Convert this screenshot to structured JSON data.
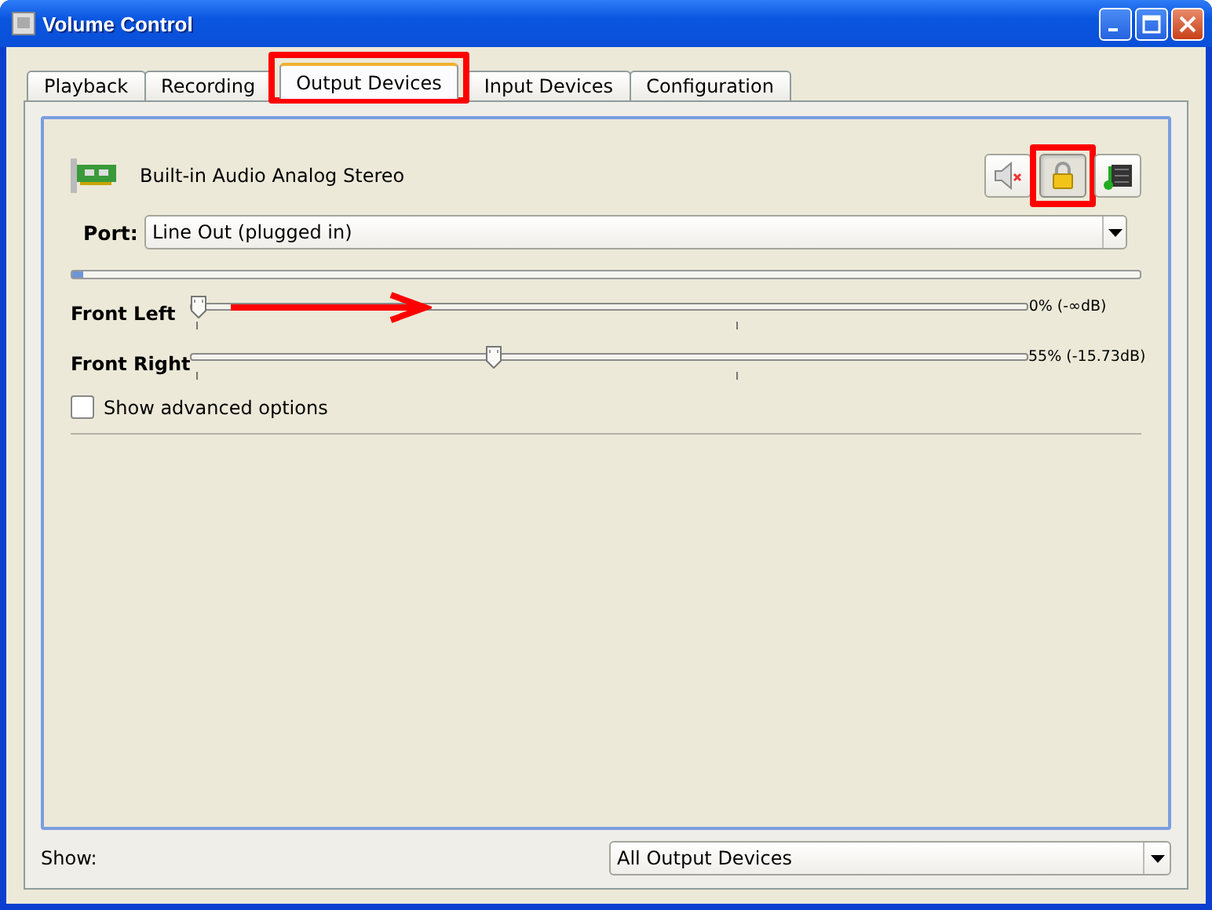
{
  "window": {
    "title": "Volume Control"
  },
  "tabs": [
    {
      "label": "Playback",
      "selected": false,
      "highlighted": false
    },
    {
      "label": "Recording",
      "selected": false,
      "highlighted": false
    },
    {
      "label": "Output Devices",
      "selected": true,
      "highlighted": true
    },
    {
      "label": "Input Devices",
      "selected": false,
      "highlighted": false
    },
    {
      "label": "Configuration",
      "selected": false,
      "highlighted": false
    }
  ],
  "device": {
    "name": "Built-in Audio Analog Stereo",
    "muted": false,
    "locked": true,
    "lock_highlighted": true,
    "port": {
      "label": "Port:",
      "value": "Line Out (plugged in)"
    },
    "meter": {
      "level": 0.01
    },
    "channels": [
      {
        "name": "Front Left",
        "level": 0,
        "reading": "0% (-∞dB)",
        "arrow": true
      },
      {
        "name": "Front Right",
        "level": 0.36,
        "reading": "55% (-15.73dB)",
        "arrow": false
      }
    ],
    "advanced": {
      "label": "Show advanced options",
      "checked": false
    }
  },
  "footer": {
    "label": "Show:",
    "value": "All Output Devices"
  }
}
